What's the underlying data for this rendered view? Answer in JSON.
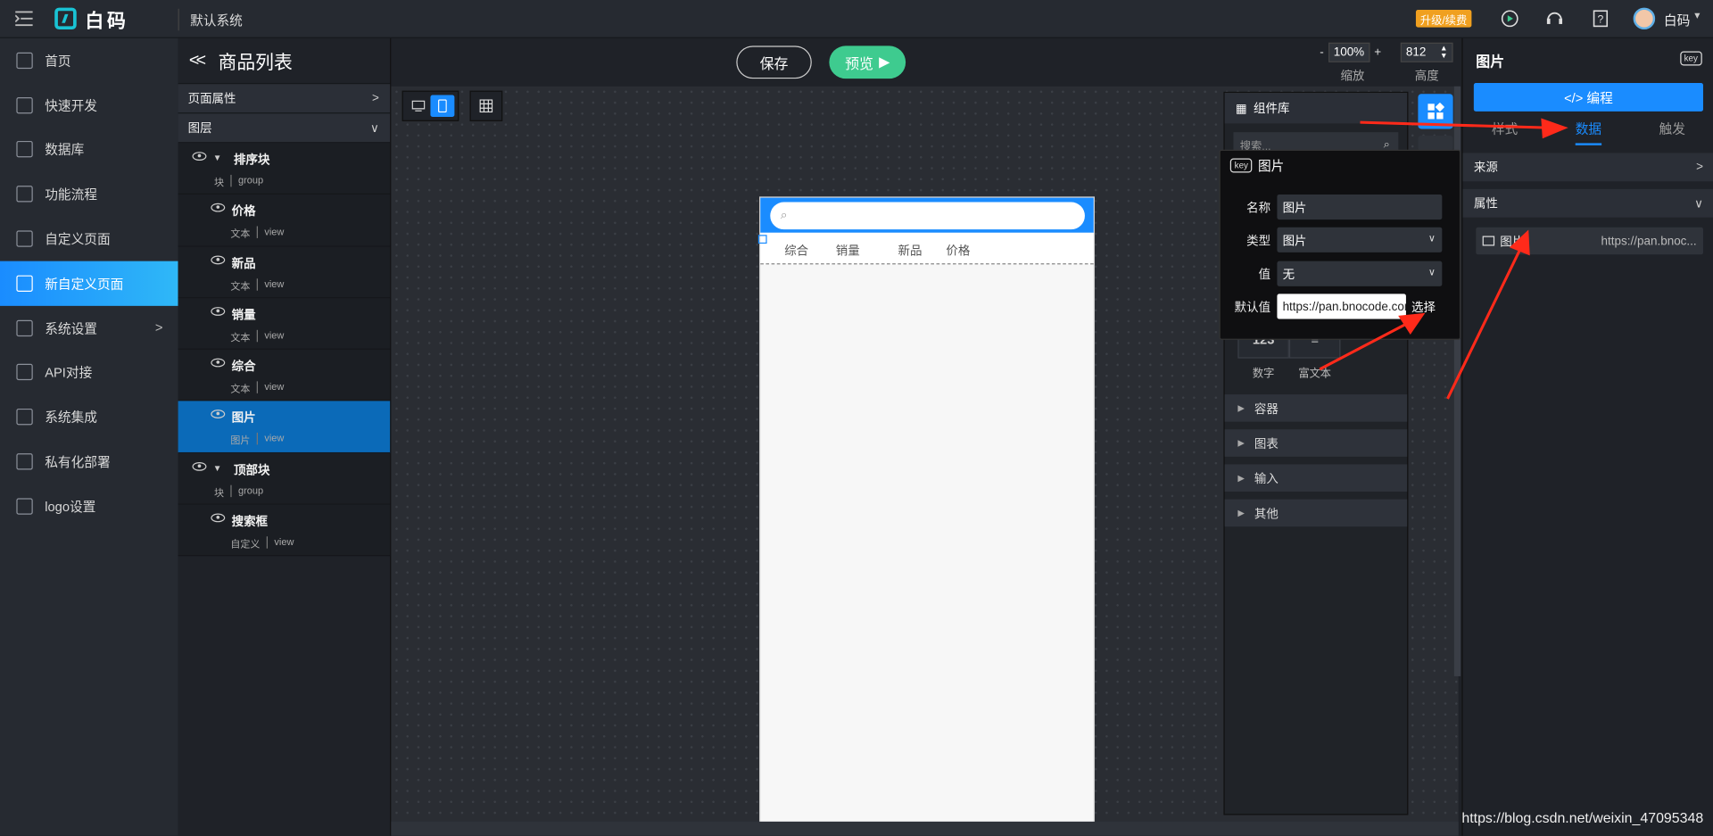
{
  "app": {
    "brand": "白码",
    "system": "默认系统",
    "upgrade": "升级/续费",
    "user": "白码"
  },
  "sidebar": {
    "items": [
      {
        "label": "首页"
      },
      {
        "label": "快速开发"
      },
      {
        "label": "数据库"
      },
      {
        "label": "功能流程"
      },
      {
        "label": "自定义页面"
      },
      {
        "label": "新自定义页面",
        "active": true
      },
      {
        "label": "系统设置",
        "has_arrow": true
      },
      {
        "label": "API对接"
      },
      {
        "label": "系统集成"
      },
      {
        "label": "私有化部署"
      },
      {
        "label": "logo设置"
      }
    ]
  },
  "page": {
    "title": "商品列表",
    "save": "保存",
    "preview": "预览",
    "zoom": "100%",
    "zoom_label": "缩放",
    "height": "812",
    "height_label": "高度",
    "minus": "-",
    "plus": "+"
  },
  "layers": {
    "page_props": "页面属性",
    "layers_title": "图层",
    "items": [
      {
        "name": "排序块",
        "type": "块",
        "kind": "group",
        "level": 0,
        "collapsible": true
      },
      {
        "name": "价格",
        "type": "文本",
        "kind": "view",
        "level": 1
      },
      {
        "name": "新品",
        "type": "文本",
        "kind": "view",
        "level": 1
      },
      {
        "name": "销量",
        "type": "文本",
        "kind": "view",
        "level": 1
      },
      {
        "name": "综合",
        "type": "文本",
        "kind": "view",
        "level": 1
      },
      {
        "name": "图片",
        "type": "图片",
        "kind": "view",
        "level": 1,
        "selected": true
      },
      {
        "name": "顶部块",
        "type": "块",
        "kind": "group",
        "level": 0,
        "collapsible": true
      },
      {
        "name": "搜索框",
        "type": "自定义",
        "kind": "view",
        "level": 1
      }
    ]
  },
  "phone": {
    "tabs": [
      "综合",
      "销量",
      "新品",
      "价格"
    ]
  },
  "complib": {
    "title": "组件库",
    "search_placeholder": "搜索...",
    "items": [
      "数字",
      "富文本"
    ],
    "sections": [
      "容器",
      "图表",
      "输入",
      "其他"
    ]
  },
  "popup": {
    "key": "key",
    "title": "图片",
    "name_label": "名称",
    "name_value": "图片",
    "type_label": "类型",
    "type_value": "图片",
    "value_label": "值",
    "value_value": "无",
    "default_label": "默认值",
    "default_value": "https://pan.bnocode.com",
    "choose": "选择"
  },
  "right": {
    "title": "图片",
    "key": "key",
    "code_btn": "</> 编程",
    "tabs": [
      "样式",
      "数据",
      "触发"
    ],
    "active_tab": "数据",
    "source": "来源",
    "props": "属性",
    "prop_name": "图片",
    "prop_value": "https://pan.bnoc..."
  },
  "watermark": "https://blog.csdn.net/weixin_47095348",
  "colors": {
    "accent": "#1a8cff",
    "preview": "#3ecb8f",
    "upgrade": "#f0a020",
    "arrow": "#ff2a1a"
  }
}
